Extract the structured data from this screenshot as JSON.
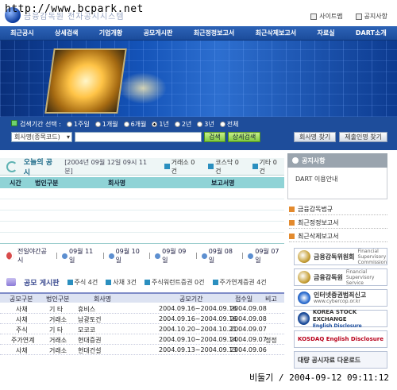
{
  "watermark": "http://www.bcpark.net",
  "logo_text": "금융감독원 전자공시시스템",
  "top_links": [
    {
      "label": "사이트맵",
      "icon": "sitemap-icon"
    },
    {
      "label": "공지사항",
      "icon": "notice-icon"
    }
  ],
  "nav": [
    "최근공시",
    "상세검색",
    "기업개황",
    "공모게시판",
    "최근정정보고서",
    "최근삭제보고서",
    "자료실",
    "DART소개"
  ],
  "search": {
    "period_label": "검색기간 선택 :",
    "periods": [
      "1주일",
      "1개월",
      "6개월",
      "1년",
      "2년",
      "3년",
      "전체"
    ],
    "selected_period": "1년",
    "select_value": "회사명(종목코드)",
    "search_button": "검색",
    "detail_button": "상세검색",
    "company_search": "회사명 찾기",
    "relay_search": "제출인명 찾기"
  },
  "today": {
    "title": "오늘의 공시",
    "time": "[2004년 09월 12일 09시 11분]",
    "counts": [
      {
        "label": "거래소 0 건"
      },
      {
        "label": "코스닥 0 건"
      },
      {
        "label": "기타 0 건"
      }
    ],
    "headers": [
      "시간",
      "법인구분",
      "회사명",
      "보고서명"
    ]
  },
  "prev_dates": {
    "label": "전일야간공시",
    "dates": [
      "09월 11일",
      "09월 10일",
      "09월 09일",
      "09월 08일",
      "09월 07일"
    ]
  },
  "ipo": {
    "title": "공모 게시판",
    "counts": [
      "주식 4건",
      "사채 3건",
      "주식워런트증권 0건",
      "주가연계증권 4건"
    ],
    "headers": [
      "공모구분",
      "법인구분",
      "회사명",
      "공모기간",
      "접수일",
      "비고"
    ],
    "rows": [
      {
        "type": "사채",
        "market": "기  타",
        "company": "휴비스",
        "period": "2004.09.16~2004.09.16",
        "date": "2004.09.08",
        "note": ""
      },
      {
        "type": "사채",
        "market": "거래소",
        "company": "남광토건",
        "period": "2004.09.16~2004.09.16",
        "date": "2004.09.08",
        "note": ""
      },
      {
        "type": "주식",
        "market": "기  타",
        "company": "모코코",
        "period": "2004.10.20~2004.10.21",
        "date": "2004.09.07",
        "note": ""
      },
      {
        "type": "주가연계",
        "market": "거래소",
        "company": "현대증권",
        "period": "2004.09.10~2004.09.14",
        "date": "2004.09.07",
        "note": "정정"
      },
      {
        "type": "사채",
        "market": "거래소",
        "company": "현대건설",
        "period": "2004.09.13~2004.09.13",
        "date": "2004.09.06",
        "note": ""
      }
    ]
  },
  "notice": {
    "title": "공지사항",
    "items": [
      "DART 이용안내"
    ]
  },
  "right_links": [
    "금융감독법규",
    "최근정정보고서",
    "최근삭제보고서"
  ],
  "banners": [
    {
      "title": "금융감독위원회",
      "sub": "Financial Supervisory Commission"
    },
    {
      "title": "금융감독원",
      "sub": "Financial Supervisory Service"
    },
    {
      "title": "인터넷증권범죄신고",
      "sub": "www.cybercop.or.kr"
    },
    {
      "title": "KOREA STOCK EXCHANGE",
      "sub": "English Disclosure"
    },
    {
      "title": "KOSDAQ English Disclosure",
      "sub": ""
    },
    {
      "title": "대량 공시자료 다운로드",
      "sub": ""
    }
  ],
  "footer_stamp": "비둘기 / 2004-09-12 09:11:12",
  "colors": {
    "nav": "#1b4c9b",
    "teal_head": "#8fd3d6",
    "search_bg": "#1e4d9b"
  }
}
